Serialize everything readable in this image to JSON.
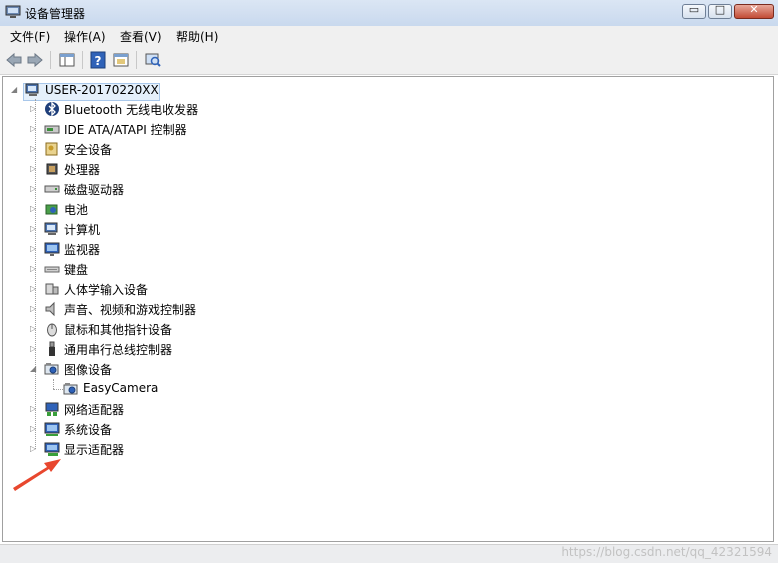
{
  "window": {
    "title": "设备管理器",
    "min_glyph": "▭",
    "max_glyph": "□",
    "close_glyph": "✕",
    "close_color": "#c24b35"
  },
  "menu": [
    "文件(F)",
    "操作(A)",
    "查看(V)",
    "帮助(H)"
  ],
  "toolbar": {
    "buttons": [
      "back-icon",
      "forward-icon",
      "console-tree-icon",
      "help-icon",
      "properties-icon",
      "scan-hardware-icon"
    ]
  },
  "tree": {
    "root": {
      "label": "USER-20170220XX",
      "expanded": true,
      "icon": "computer-icon"
    },
    "items": [
      {
        "label": "Bluetooth 无线电收发器",
        "icon": "bluetooth-icon"
      },
      {
        "label": "IDE ATA/ATAPI 控制器",
        "icon": "ide-controller-icon"
      },
      {
        "label": "安全设备",
        "icon": "security-key-icon"
      },
      {
        "label": "处理器",
        "icon": "processor-icon"
      },
      {
        "label": "磁盘驱动器",
        "icon": "disk-drive-icon"
      },
      {
        "label": "电池",
        "icon": "battery-icon"
      },
      {
        "label": "计算机",
        "icon": "computer-icon"
      },
      {
        "label": "监视器",
        "icon": "monitor-icon"
      },
      {
        "label": "键盘",
        "icon": "keyboard-icon"
      },
      {
        "label": "人体学输入设备",
        "icon": "hid-icon"
      },
      {
        "label": "声音、视频和游戏控制器",
        "icon": "speaker-icon"
      },
      {
        "label": "鼠标和其他指针设备",
        "icon": "mouse-icon"
      },
      {
        "label": "通用串行总线控制器",
        "icon": "usb-icon"
      },
      {
        "label": "图像设备",
        "icon": "camera-icon",
        "expanded": true,
        "children": [
          {
            "label": "EasyCamera",
            "icon": "camera-icon"
          }
        ]
      },
      {
        "label": "网络适配器",
        "icon": "network-adapter-icon"
      },
      {
        "label": "系统设备",
        "icon": "system-device-icon"
      },
      {
        "label": "显示适配器",
        "icon": "display-adapter-icon"
      }
    ]
  },
  "annotation": {
    "arrow_color": "#e8472e"
  },
  "status": {
    "watermark": "https://blog.csdn.net/qq_42321594"
  }
}
